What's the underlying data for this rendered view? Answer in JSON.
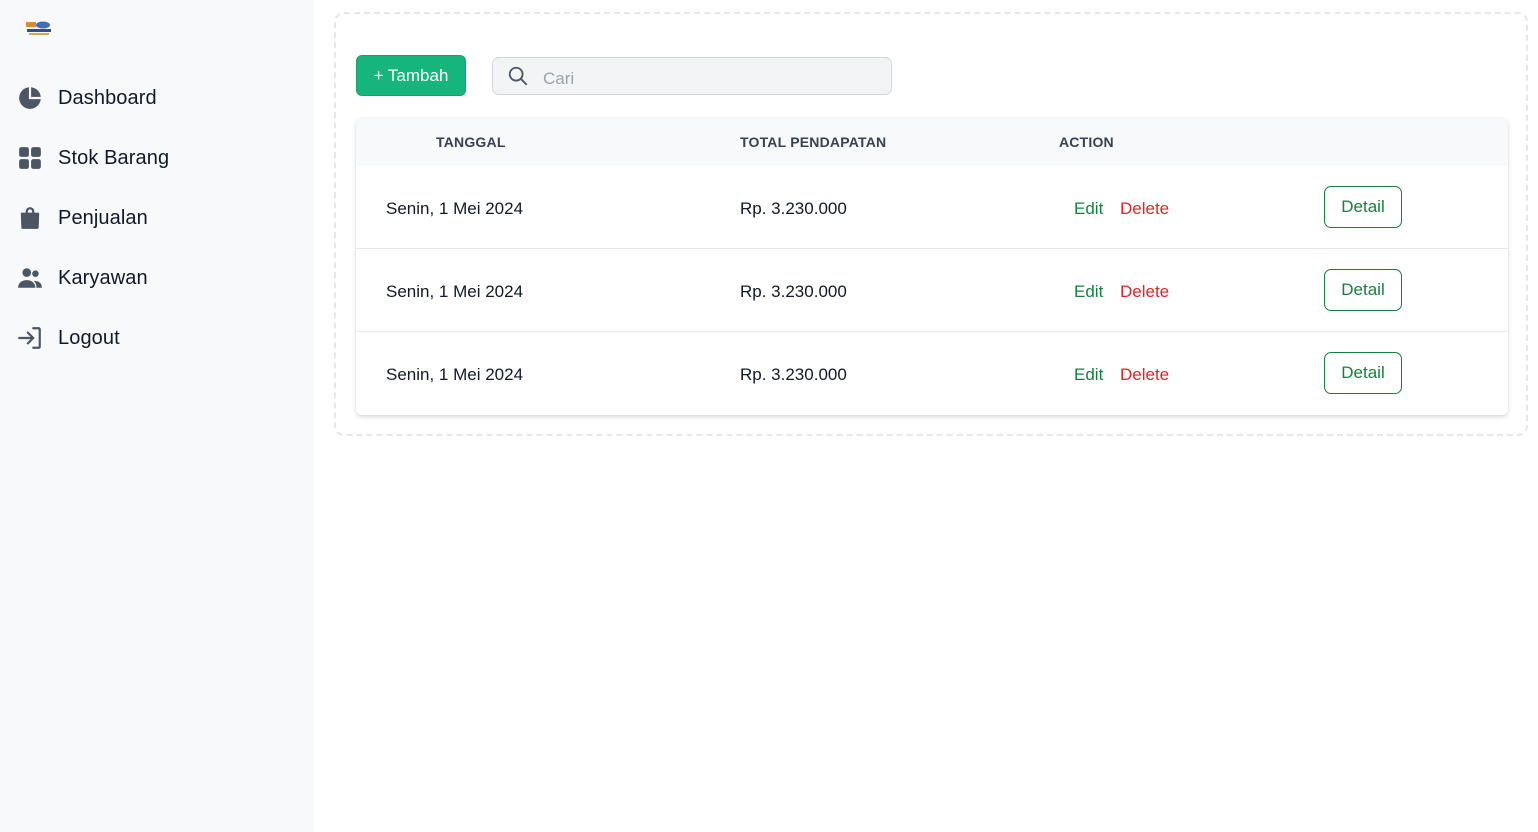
{
  "sidebar": {
    "items": [
      {
        "label": "Dashboard",
        "icon": "pie-chart-icon"
      },
      {
        "label": "Stok Barang",
        "icon": "grid-icon"
      },
      {
        "label": "Penjualan",
        "icon": "shopping-bag-icon"
      },
      {
        "label": "Karyawan",
        "icon": "users-icon"
      },
      {
        "label": "Logout",
        "icon": "logout-icon"
      }
    ]
  },
  "toolbar": {
    "add_label": "+ Tambah",
    "search_placeholder": "Cari"
  },
  "table": {
    "headers": [
      "TANGGAL",
      "TOTAL PENDAPATAN",
      "ACTION"
    ],
    "rows": [
      {
        "tanggal": "Senin, 1 Mei 2024",
        "total": "Rp. 3.230.000",
        "edit": "Edit",
        "delete": "Delete",
        "detail": "Detail"
      },
      {
        "tanggal": "Senin, 1 Mei 2024",
        "total": "Rp. 3.230.000",
        "edit": "Edit",
        "delete": "Delete",
        "detail": "Detail"
      },
      {
        "tanggal": "Senin, 1 Mei 2024",
        "total": "Rp. 3.230.000",
        "edit": "Edit",
        "delete": "Delete",
        "detail": "Detail"
      }
    ]
  },
  "colors": {
    "primary_green": "#16b57d",
    "link_green": "#15803d",
    "danger_red": "#dc2626",
    "sidebar_bg": "#f8f9fb"
  }
}
